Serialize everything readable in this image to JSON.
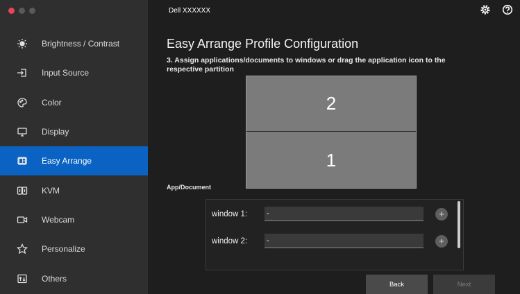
{
  "app": {
    "title": "Dell XXXXXX"
  },
  "sidebar": {
    "items": [
      {
        "label": "Brightness / Contrast",
        "icon": "brightness-icon",
        "active": false
      },
      {
        "label": "Input Source",
        "icon": "input-source-icon",
        "active": false
      },
      {
        "label": "Color",
        "icon": "color-icon",
        "active": false
      },
      {
        "label": "Display",
        "icon": "display-icon",
        "active": false
      },
      {
        "label": "Easy Arrange",
        "icon": "easy-arrange-icon",
        "active": true
      },
      {
        "label": "KVM",
        "icon": "kvm-icon",
        "active": false
      },
      {
        "label": "Webcam",
        "icon": "webcam-icon",
        "active": false
      },
      {
        "label": "Personalize",
        "icon": "star-icon",
        "active": false
      },
      {
        "label": "Others",
        "icon": "others-icon",
        "active": false
      }
    ]
  },
  "header": {
    "settings_icon": "gear-icon",
    "help_icon": "help-icon"
  },
  "main": {
    "title": "Easy Arrange Profile Configuration",
    "instruction": "3. Assign applications/documents to windows or drag the application icon to the respective partition",
    "partitions": [
      {
        "label": "2"
      },
      {
        "label": "1"
      }
    ],
    "app_document_label": "App/Document",
    "windows": [
      {
        "label": "window 1:",
        "value": "-"
      },
      {
        "label": "window 2:",
        "value": "-"
      }
    ],
    "add_symbol": "+",
    "back_label": "Back",
    "next_label": "Next"
  },
  "colors": {
    "accent": "#0a62c2",
    "sidebar_bg": "#2f2f2f",
    "main_bg": "#1e1e1e",
    "partition_bg": "#7b7b7b",
    "close_dot": "#e9445a"
  }
}
